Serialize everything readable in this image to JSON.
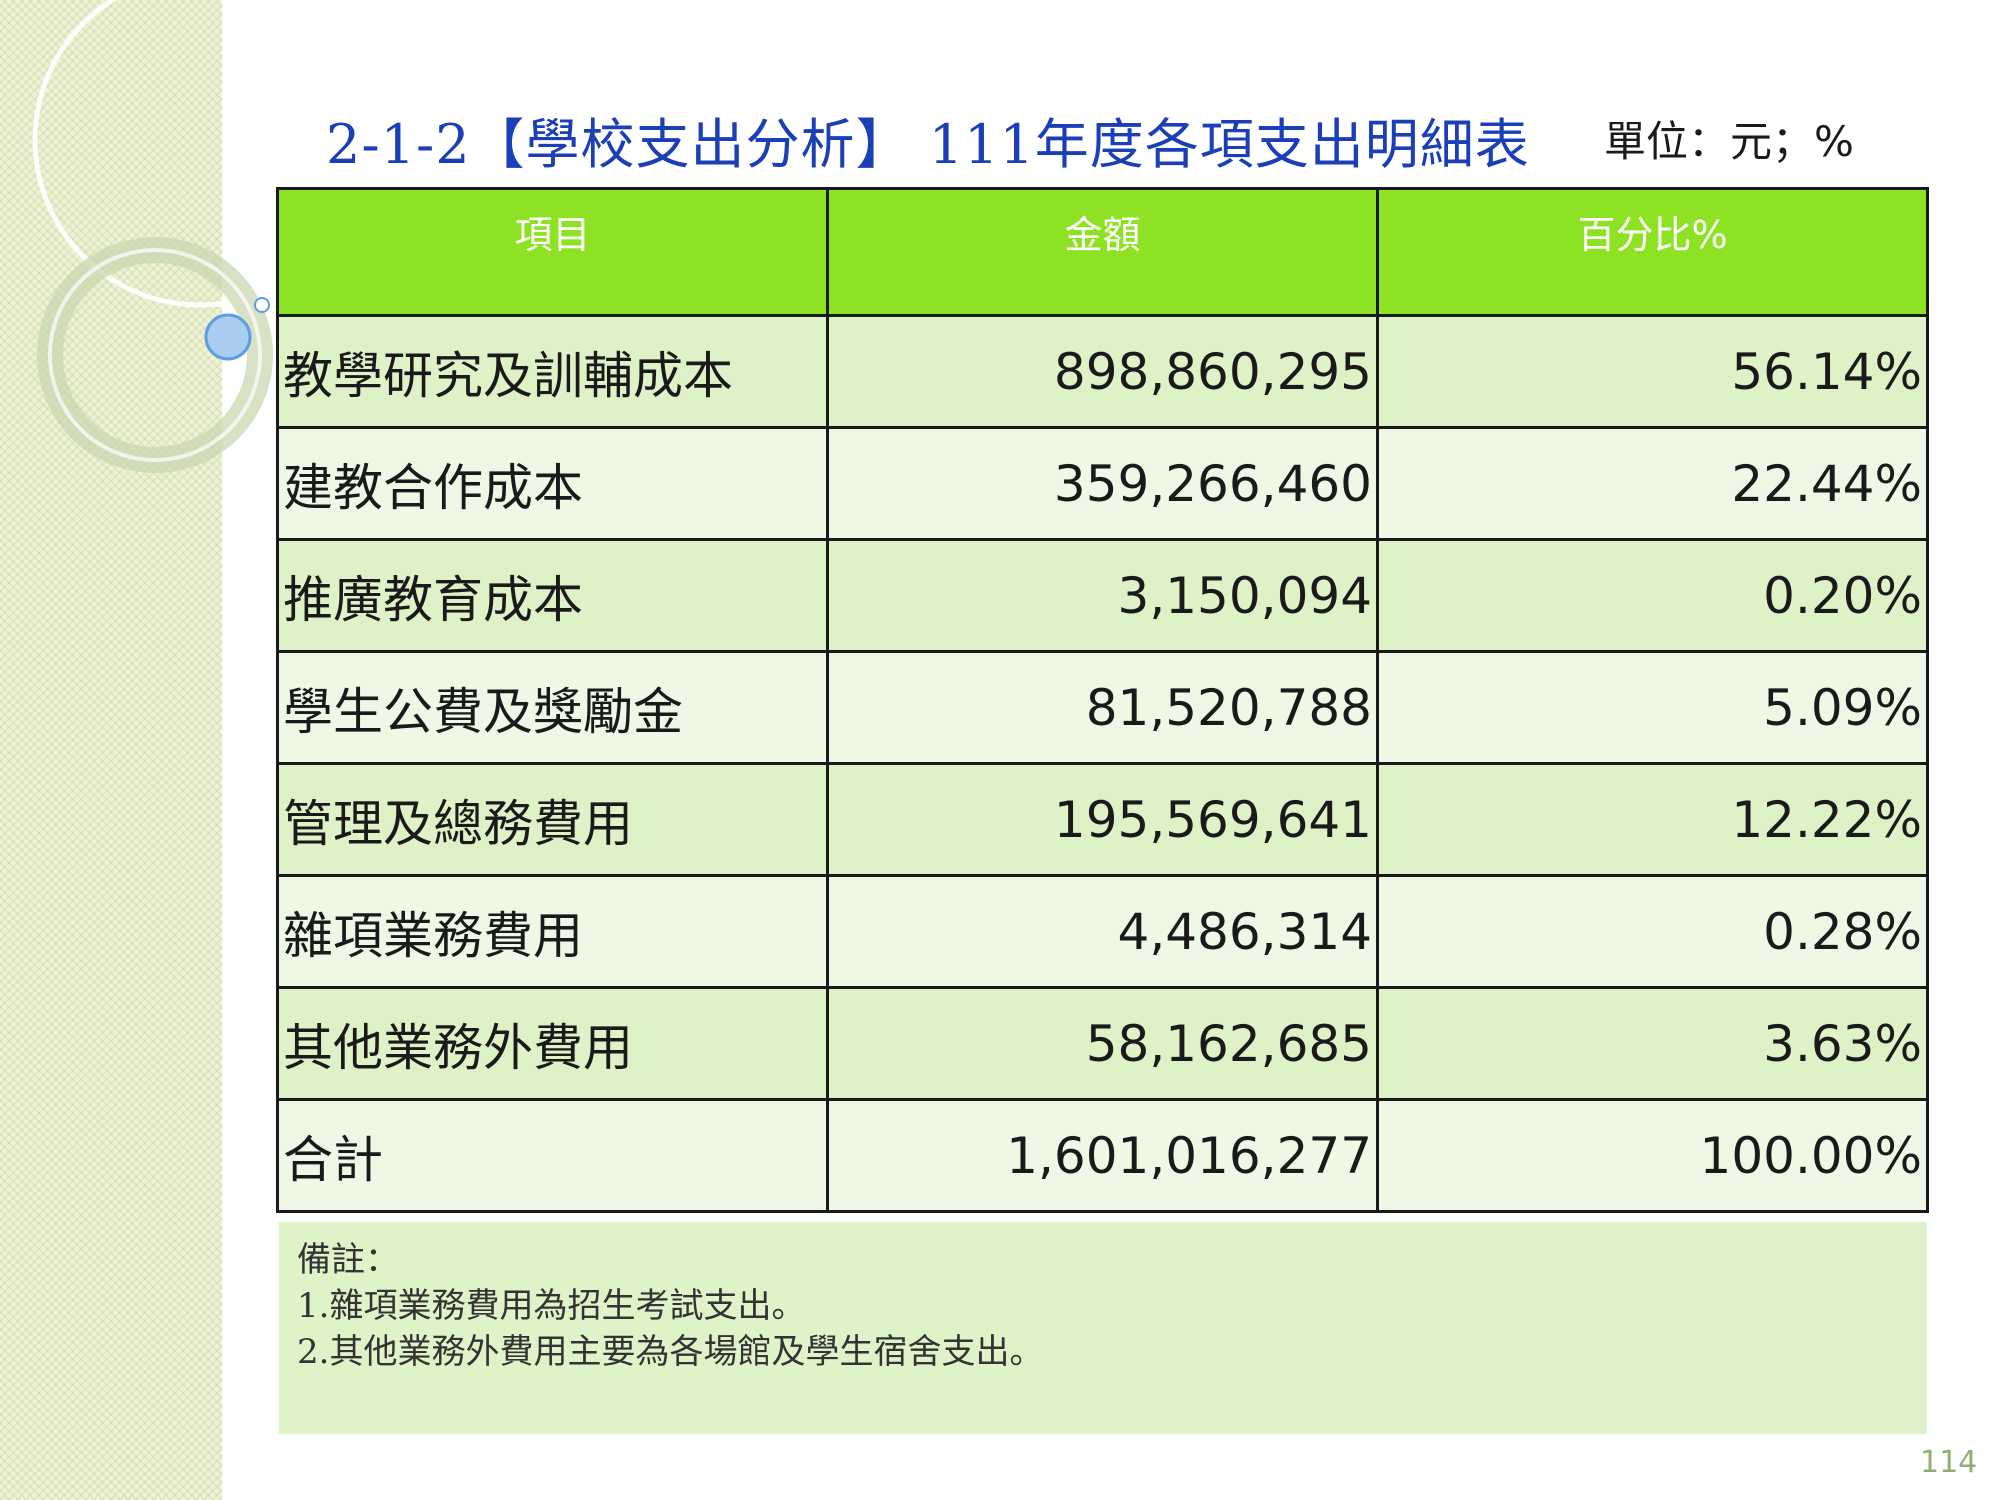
{
  "title": {
    "text": "2-1-2【學校支出分析】 111年度各項支出明細表",
    "unit": "單位：元；%"
  },
  "table": {
    "headers": [
      "項目",
      "金額",
      "百分比%"
    ],
    "rows": [
      {
        "item": "教學研究及訓輔成本",
        "amount": "898,860,295",
        "percent": "56.14%"
      },
      {
        "item": "建教合作成本",
        "amount": "359,266,460",
        "percent": "22.44%"
      },
      {
        "item": "推廣教育成本",
        "amount": "3,150,094",
        "percent": "0.20%"
      },
      {
        "item": "學生公費及獎勵金",
        "amount": "81,520,788",
        "percent": "5.09%"
      },
      {
        "item": "管理及總務費用",
        "amount": "195,569,641",
        "percent": "12.22%"
      },
      {
        "item": "雜項業務費用",
        "amount": "4,486,314",
        "percent": "0.28%"
      },
      {
        "item": "其他業務外費用",
        "amount": "58,162,685",
        "percent": "3.63%"
      },
      {
        "item": "合計",
        "amount": "1,601,016,277",
        "percent": "100.00%"
      }
    ]
  },
  "notes": {
    "heading": "備註：",
    "lines": [
      "1.雜項業務費用為招生考試支出。",
      "2.其他業務外費用主要為各場館及學生宿舍支出。"
    ]
  },
  "page_number": "114",
  "colors": {
    "title": "#1a3fb8",
    "header_bg": "#8ee224",
    "row_odd": "#def2c8",
    "row_even": "#eef8e4",
    "notes_bg": "#def4c8",
    "page_number": "#8fb070"
  }
}
